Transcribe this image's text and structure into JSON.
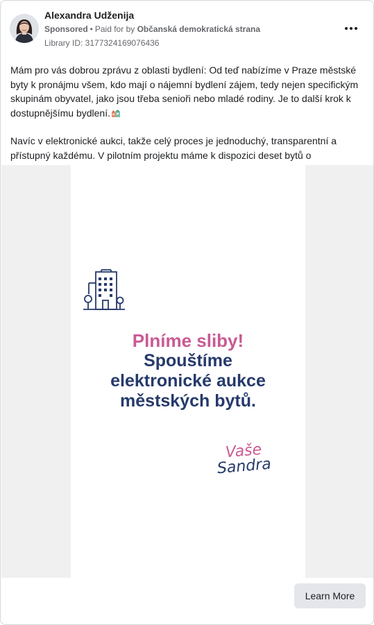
{
  "post": {
    "author": "Alexandra Udženija",
    "sponsored": "Sponsored",
    "paid_for_prefix": "Paid for by",
    "paid_for_org": "Občanská demokratická strana",
    "library_id": "Library ID: 3177324169076436",
    "paragraph1": "Mám pro vás dobrou zprávu z oblasti bydlení: Od teď nabízíme v Praze městské byty k pronájmu všem, kdo mají o nájemní bydlení zájem, tedy nejen specifickým skupinám obyvatel, jako jsou třeba senioři nebo mladé rodiny. Je to další krok k dostupnějšímu bydlení.",
    "paragraph2": "Navíc v elektronické aukci, takže celý proces je jednoduchý, transparentní a přístupný každému. V pilotním projektu máme k dispozici deset bytů o velikostec…"
  },
  "creative": {
    "headline_pink": "Plníme sliby!",
    "headline_line1": "Spouštíme",
    "headline_line2": "elektronické aukce",
    "headline_line3": "městských bytů.",
    "signature_line1": "Vaše",
    "signature_line2": "Sandra",
    "colors": {
      "pink": "#c95a94",
      "navy": "#263a6b",
      "side_panel": "#f0f0f0"
    }
  },
  "cta": {
    "label": "Learn More"
  },
  "icons": {
    "menu": "more-horizontal-icon",
    "emoji": "house-emoji-icon",
    "illustration": "city-building-icon"
  }
}
